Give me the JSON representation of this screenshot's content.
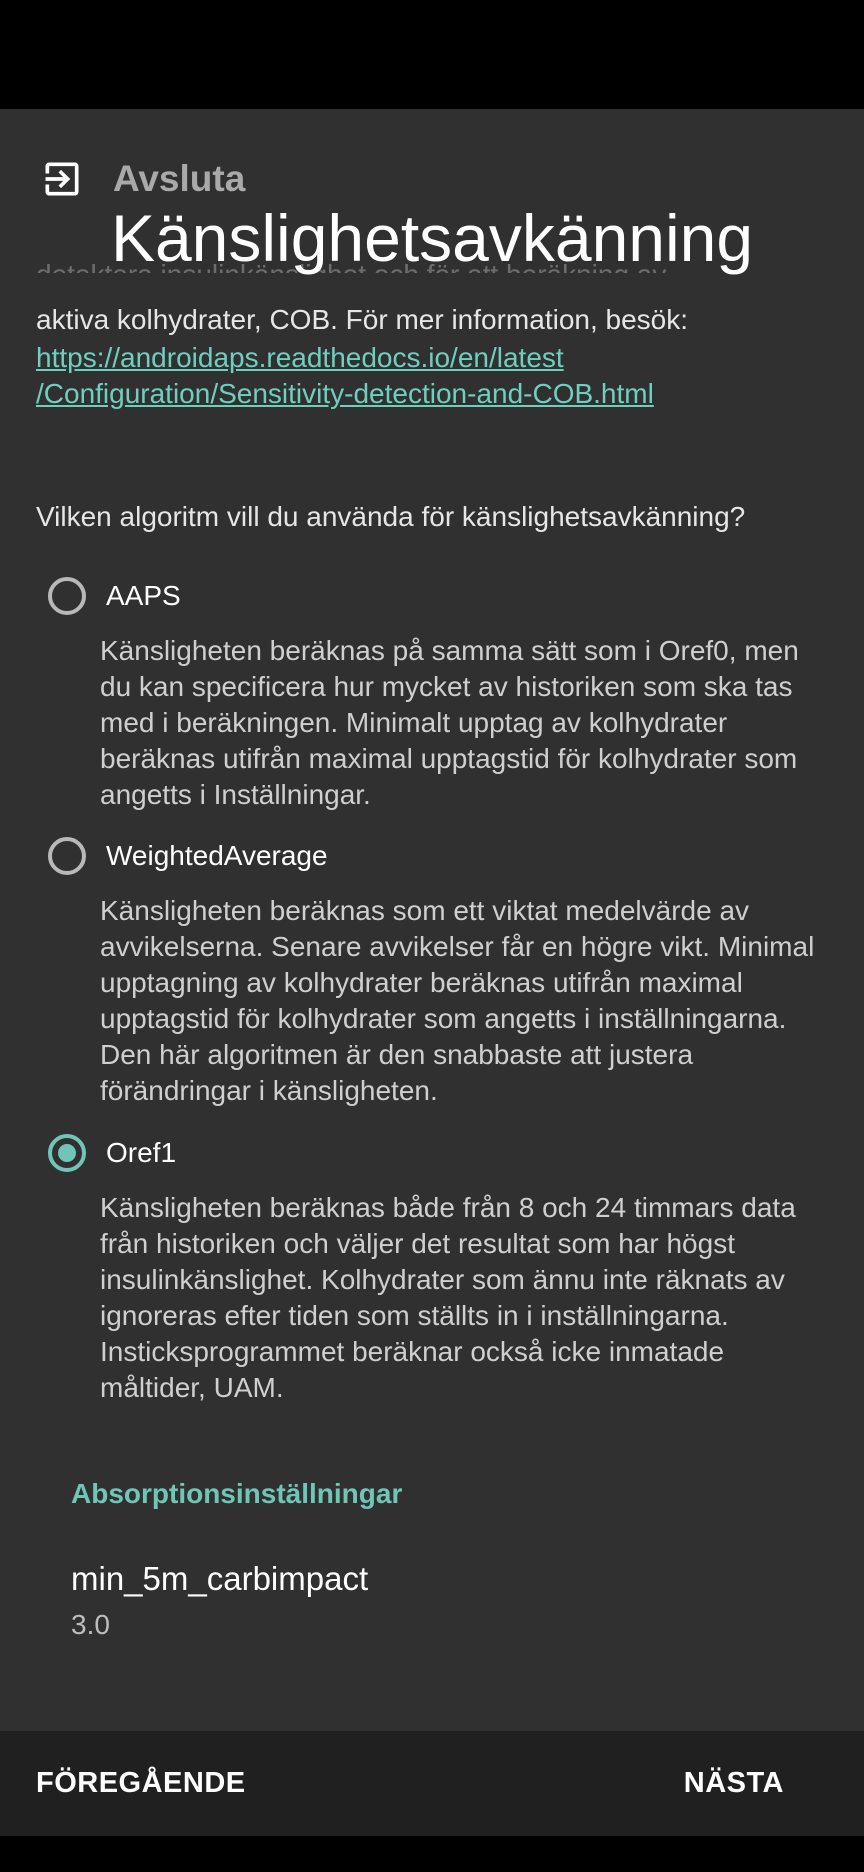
{
  "header": {
    "exit_icon": "exit-icon",
    "exit_label": "Avsluta",
    "title": "Känslighetsavkänning"
  },
  "intro": {
    "cut_line": "detektera insulinkänslighet och för att beräkning av",
    "text": "aktiva kolhydrater, COB. För mer information, besök:",
    "link_line1": "https://androidaps.readthedocs.io/en/latest",
    "link_line2": "/Configuration/Sensitivity-detection-and-COB.html"
  },
  "question": "Vilken algoritm vill du använda för känslighetsavkänning?",
  "options": [
    {
      "label": "AAPS",
      "selected": false,
      "description": "Känsligheten beräknas på samma sätt som i Oref0, men du kan specificera hur mycket av historiken som ska tas med i beräkningen. Minimalt upptag av kolhydrater beräknas utifrån maximal upptagstid för kolhydrater som angetts i Inställningar."
    },
    {
      "label": "WeightedAverage",
      "selected": false,
      "description": "Känsligheten beräknas som ett viktat medelvärde av avvikelserna. Senare avvikelser får en högre vikt. Minimal upptagning av kolhydrater beräknas utifrån maximal upptagstid för kolhydrater som angetts i inställningarna. Den här algoritmen är den snabbaste att justera förändringar i känsligheten."
    },
    {
      "label": "Oref1",
      "selected": true,
      "description": "Känsligheten beräknas både från 8 och 24 timmars data från historiken och väljer det resultat som har högst insulinkänslighet. Kolhydrater som ännu inte räknats av ignoreras efter tiden som ställts in i inställningarna. Insticksprogrammet beräknar också icke inmatade måltider, UAM."
    }
  ],
  "absorption": {
    "header": "Absorptionsinställningar",
    "pref_title": "min_5m_carbimpact",
    "pref_value": "3.0"
  },
  "nav": {
    "prev_label": "FÖREGÅENDE",
    "next_label": "NÄSTA"
  },
  "colors": {
    "accent": "#6fc6b6",
    "background": "#303030",
    "bottom_bar": "#202020"
  }
}
